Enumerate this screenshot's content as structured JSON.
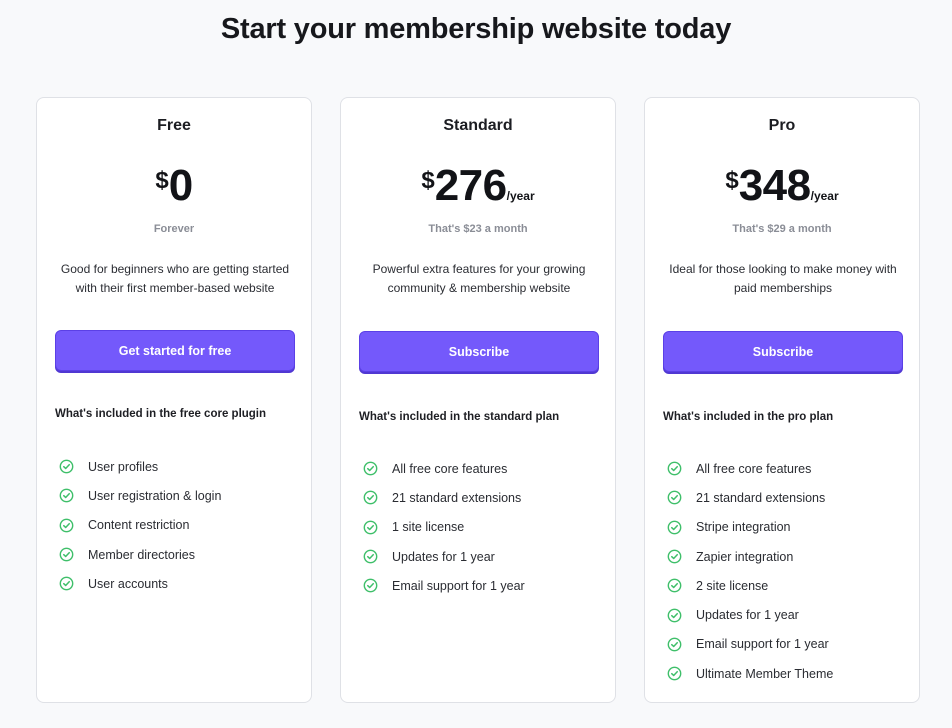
{
  "page": {
    "title": "Start your membership website today"
  },
  "colors": {
    "accent": "#7459fb",
    "check": "#3fbf6a",
    "background": "#f8f9fb"
  },
  "plans": [
    {
      "name": "Free",
      "currency": "$",
      "amount": "0",
      "period": "",
      "subprice": "Forever",
      "description": "Good for beginners who are getting started with their first member-based website",
      "cta": "Get started for free",
      "included_heading": "What's included in the free core plugin",
      "features": [
        "User profiles",
        "User registration & login",
        "Content restriction",
        "Member directories",
        "User accounts"
      ]
    },
    {
      "name": "Standard",
      "currency": "$",
      "amount": "276",
      "period": "/year",
      "subprice": "That's $23 a month",
      "description": "Powerful extra features for your growing community & membership website",
      "cta": "Subscribe",
      "included_heading": "What's included in the standard plan",
      "features": [
        "All free core features",
        "21 standard extensions",
        "1 site license",
        "Updates for 1 year",
        "Email support for 1 year"
      ]
    },
    {
      "name": "Pro",
      "currency": "$",
      "amount": "348",
      "period": "/year",
      "subprice": "That's $29 a month",
      "description": "Ideal for those looking to make money with paid memberships",
      "cta": "Subscribe",
      "included_heading": "What's included in the pro plan",
      "features": [
        "All free core features",
        "21 standard extensions",
        "Stripe integration",
        "Zapier integration",
        "2 site license",
        "Updates for 1 year",
        "Email support for 1 year",
        "Ultimate Member Theme"
      ]
    }
  ],
  "icons": {
    "feature": "check-circle-icon"
  }
}
